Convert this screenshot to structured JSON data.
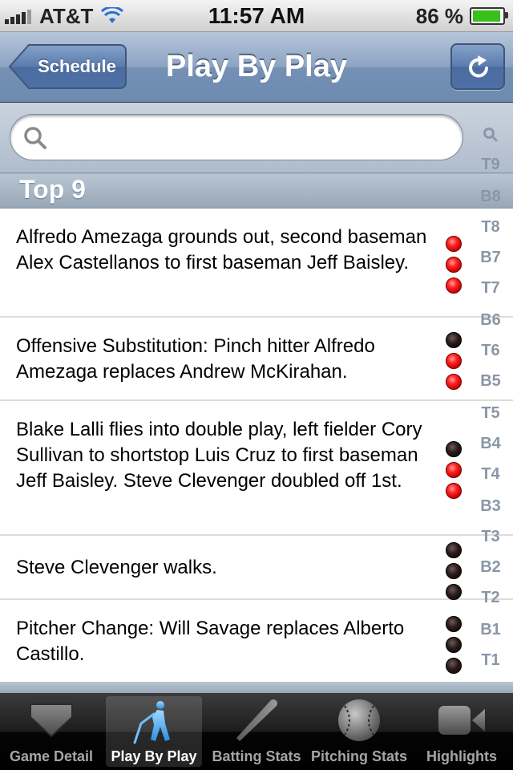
{
  "status_bar": {
    "carrier": "AT&T",
    "time": "11:57 AM",
    "battery": "86 %"
  },
  "nav": {
    "back_label": "Schedule",
    "title": "Play By Play"
  },
  "search": {
    "placeholder": ""
  },
  "section": {
    "title": "Top 9"
  },
  "plays": [
    {
      "text": "Alfredo Amezaga grounds out, second baseman Alex Castellanos to first baseman Jeff Baisley.",
      "outs": [
        "red",
        "red",
        "red"
      ]
    },
    {
      "text": "Offensive Substitution: Pinch hitter Alfredo Amezaga replaces Andrew McKirahan.",
      "outs": [
        "dark",
        "red",
        "red"
      ]
    },
    {
      "text": "Blake Lalli flies into double play, left fielder Cory Sullivan to shortstop Luis Cruz to first baseman Jeff Baisley.  Steve Clevenger doubled off 1st.",
      "outs": [
        "dark",
        "red",
        "red"
      ]
    },
    {
      "text": "Steve Clevenger walks.",
      "outs": [
        "dark",
        "dark",
        "dark"
      ]
    },
    {
      "text": "Pitcher Change: Will Savage replaces Alberto Castillo.",
      "outs": [
        "dark",
        "dark",
        "dark"
      ]
    }
  ],
  "index": [
    "T9",
    "B8",
    "T8",
    "B7",
    "T7",
    "B6",
    "T6",
    "B5",
    "T5",
    "B4",
    "T4",
    "B3",
    "T3",
    "B2",
    "T2",
    "B1",
    "T1"
  ],
  "tabs": [
    {
      "label": "Game Detail",
      "icon": "home-plate-icon"
    },
    {
      "label": "Play By Play",
      "icon": "batter-icon",
      "active": true
    },
    {
      "label": "Batting Stats",
      "icon": "bat-icon"
    },
    {
      "label": "Pitching Stats",
      "icon": "baseball-icon"
    },
    {
      "label": "Highlights",
      "icon": "video-camera-icon"
    }
  ],
  "colors": {
    "nav_blue": "#6d8ab0",
    "out_red": "#ff2222",
    "out_empty": "#1a0a0a",
    "index_gray": "#8a96a6"
  }
}
